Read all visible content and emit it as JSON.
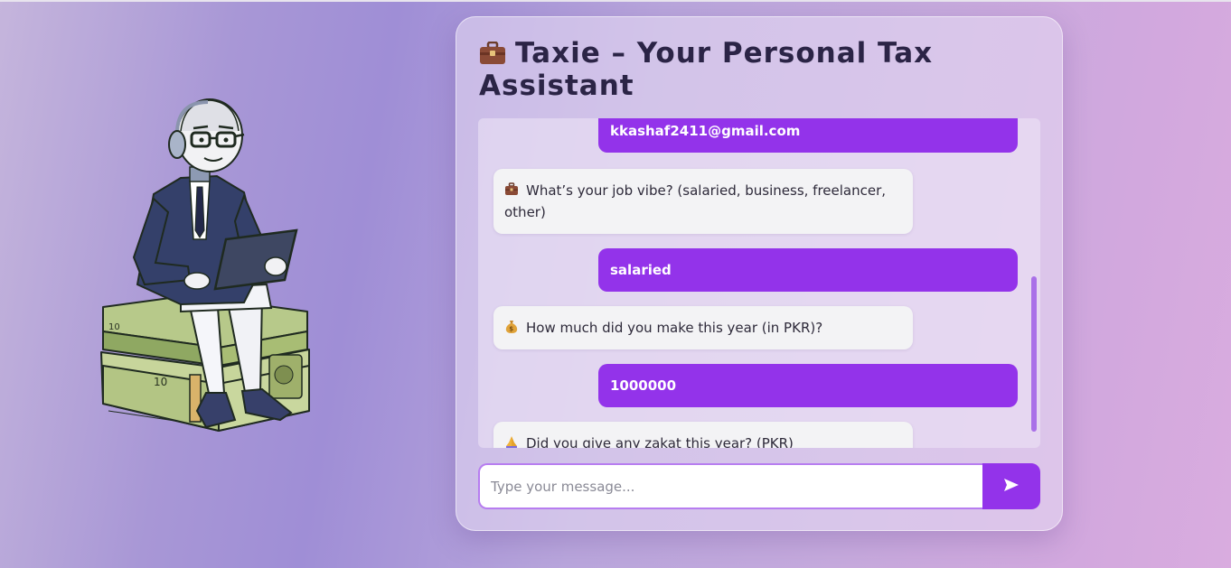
{
  "header": {
    "title": "Taxie – Your Personal Tax Assistant",
    "title_icon": "briefcase-icon"
  },
  "messages": [
    {
      "role": "user",
      "text": "kkashaf2411@gmail.com"
    },
    {
      "role": "bot",
      "icon": "briefcase-icon",
      "text": "What’s your job vibe? (salaried, business, freelancer, other)"
    },
    {
      "role": "user",
      "text": "salaried"
    },
    {
      "role": "bot",
      "icon": "money-bag-icon",
      "text": "How much did you make this year (in PKR)?"
    },
    {
      "role": "user",
      "text": "1000000"
    },
    {
      "role": "bot",
      "icon": "praying-hands-icon",
      "text": "Did you give any zakat this year? (PKR)"
    }
  ],
  "composer": {
    "placeholder": "Type your message...",
    "send_icon": "send-arrow-icon"
  },
  "colors": {
    "accent": "#9333ea",
    "bot_bubble": "#f3f3f5",
    "title_text": "#2b2446"
  }
}
